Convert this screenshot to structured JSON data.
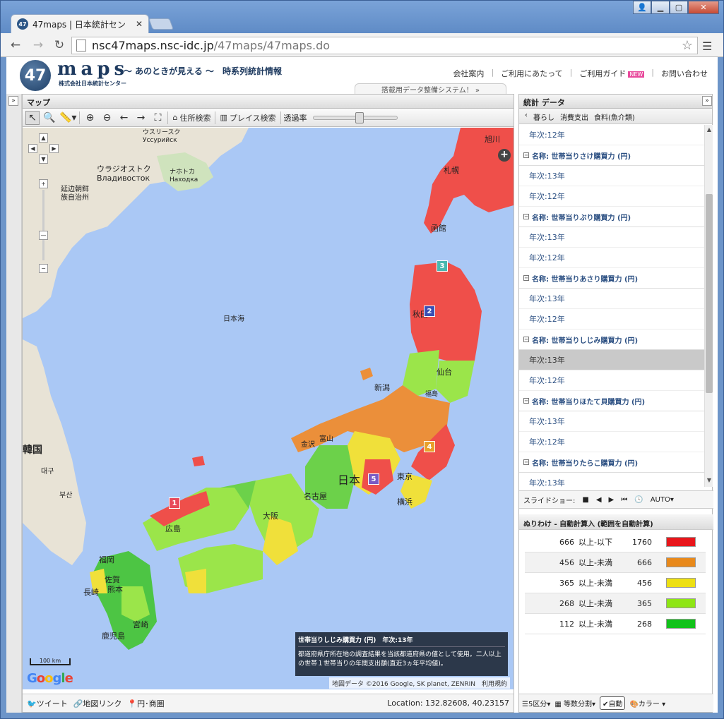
{
  "browser": {
    "tab_title": "47maps | 日本統計セン",
    "tab_icon": "47",
    "url_domain": "nsc47maps.nsc-idc.jp",
    "url_path": "/47maps/47maps.do"
  },
  "header": {
    "logo_num": "47",
    "logo_text": "maps",
    "tagline": "～ あのときが見える ～　時系列統計情報",
    "corp": "株式会社日本統計センター",
    "links": [
      "会社案内",
      "ご利用にあたって",
      "ご利用ガイド",
      "お問い合わせ"
    ],
    "new_badge": "NEW",
    "banner": "搭載用データ整備システム！ »"
  },
  "map_panel": {
    "title": "マップ",
    "tools": {
      "address_search": "住所検索",
      "place_search": "プレイス検索",
      "opacity": "透過率"
    },
    "opacity_level": 0.55,
    "labels": {
      "ussuriysk": "ウスリースク\nУссурийск",
      "vladivostok": "ウラジオストク\nВладивосток",
      "nakhodka": "ナホトカ\nНаходка",
      "yanbian": "延边朝鲜\n族自治州",
      "sea_of_japan": "日本海",
      "korea": "韓国",
      "daegu": "대구",
      "busan": "부산",
      "asahikawa": "旭川",
      "sapporo": "札幌",
      "hakodate": "函館",
      "akita": "秋田",
      "sendai": "仙台",
      "niigata": "新潟",
      "fukushima": "福島",
      "toyama": "富山",
      "kanazawa": "金沢",
      "japan": "日本",
      "tokyo": "東京",
      "yokohama": "横浜",
      "nagoya": "名古屋",
      "osaka": "大阪",
      "hiroshima": "広島",
      "fukuoka": "福岡",
      "saga": "佐賀",
      "kumamoto": "熊本",
      "nagasaki": "長崎",
      "miyazaki": "宮崎",
      "kagoshima": "鹿児島"
    },
    "markers": [
      "1",
      "2",
      "3",
      "4",
      "5"
    ],
    "legend_title": "世帯当りしじみ購買力 (円)　年次:13年",
    "legend_text": "都道府県庁所在地の調査結果を当該都道府県の値として使用。二人以上の世帯１世帯当りの年間支出額(直近3ヵ年平均値)。",
    "scale": "100 km",
    "google": "Google",
    "copyright": "地図データ ©2016 Google, SK planet, ZENRIN　利用規約",
    "footer": {
      "tweet": "ツイート",
      "maplink": "地図リンク",
      "pointers": "円･商圏",
      "location": "Location: 132.82608, 40.23157"
    }
  },
  "stats_panel": {
    "title": "統計 データ",
    "breadcrumb": [
      "暮らし",
      "消費支出",
      "食料(魚介類)"
    ],
    "list": [
      {
        "type": "item",
        "label": "年次:12年"
      },
      {
        "type": "cat",
        "label": "名称: 世帯当りさけ購買力 (円)"
      },
      {
        "type": "item",
        "label": "年次:13年"
      },
      {
        "type": "item",
        "label": "年次:12年"
      },
      {
        "type": "cat",
        "label": "名称: 世帯当りぶり購買力 (円)"
      },
      {
        "type": "item",
        "label": "年次:13年"
      },
      {
        "type": "item",
        "label": "年次:12年"
      },
      {
        "type": "cat",
        "label": "名称: 世帯当りあさり購買力 (円)"
      },
      {
        "type": "item",
        "label": "年次:13年"
      },
      {
        "type": "item",
        "label": "年次:12年"
      },
      {
        "type": "cat",
        "label": "名称: 世帯当りしじみ購買力 (円)"
      },
      {
        "type": "item",
        "label": "年次:13年",
        "selected": true
      },
      {
        "type": "item",
        "label": "年次:12年"
      },
      {
        "type": "cat",
        "label": "名称: 世帯当りほたて貝購買力 (円)"
      },
      {
        "type": "item",
        "label": "年次:13年"
      },
      {
        "type": "item",
        "label": "年次:12年"
      },
      {
        "type": "cat",
        "label": "名称: 世帯当りたらこ購買力 (円)"
      },
      {
        "type": "item",
        "label": "年次:13年"
      }
    ],
    "slideshow": {
      "label": "スライドショー:",
      "auto": "AUTO"
    },
    "classification_title": "ぬりわけ - 自動計算入 (範囲を自動計算)",
    "classes": [
      {
        "low": "666",
        "range": "以上-以下",
        "high": "1760",
        "color": "#e8161b"
      },
      {
        "low": "456",
        "range": "以上-未満",
        "high": "666",
        "color": "#e8891b"
      },
      {
        "low": "365",
        "range": "以上-未満",
        "high": "456",
        "color": "#ede012"
      },
      {
        "low": "268",
        "range": "以上-未満",
        "high": "365",
        "color": "#8ee514"
      },
      {
        "low": "112",
        "range": "以上-未満",
        "high": "268",
        "color": "#12c21a"
      }
    ],
    "footer": {
      "divisions": "5区分",
      "method": "等数分割",
      "auto": "自動",
      "color": "カラー"
    }
  }
}
